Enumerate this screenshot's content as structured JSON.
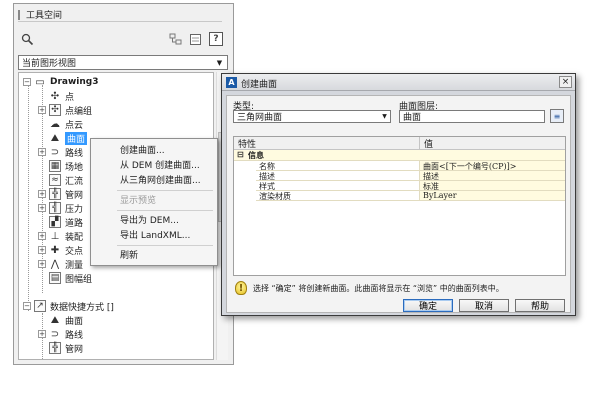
{
  "toolspace": {
    "title": "工具空间",
    "toolbar_help": "?",
    "view_select": "当前图形视图",
    "tree": {
      "drawing": "Drawing3",
      "items": [
        "点",
        "点编组",
        "点云",
        "曲面",
        "路线",
        "场地",
        "汇流",
        "管网",
        "压力",
        "道路",
        "装配",
        "交点",
        "测量",
        "图幅组"
      ],
      "shortcuts": "数据快捷方式 []",
      "shortcut_items": [
        "曲面",
        "路线",
        "管网"
      ]
    }
  },
  "context_menu": {
    "items": [
      {
        "label": "创建曲面...",
        "enabled": true
      },
      {
        "label": "从 DEM 创建曲面...",
        "enabled": true
      },
      {
        "label": "从三角网创建曲面...",
        "enabled": true
      },
      {
        "label": "显示预览",
        "enabled": false
      },
      {
        "label": "导出为 DEM...",
        "enabled": true
      },
      {
        "label": "导出 LandXML...",
        "enabled": true
      },
      {
        "label": "刷新",
        "enabled": true
      }
    ]
  },
  "dialog": {
    "title": "创建曲面",
    "close": "×",
    "app_icon": "A",
    "type_label": "类型:",
    "type_value": "三角网曲面",
    "layer_label": "曲面图层:",
    "layer_value": "曲面",
    "table": {
      "col_property": "特性",
      "col_value": "值",
      "group": "信息",
      "rows": [
        {
          "name": "名称",
          "value": "曲面<[下一个编号(CP)]>"
        },
        {
          "name": "描述",
          "value": "描述"
        },
        {
          "name": "样式",
          "value": "标准"
        },
        {
          "name": "渲染材质",
          "value": "ByLayer"
        }
      ]
    },
    "info_text": "选择 “确定” 将创建新曲面。此曲面将显示在 “浏览” 中的曲面列表中。",
    "buttons": {
      "ok": "确定",
      "cancel": "取消",
      "help": "帮助"
    }
  }
}
